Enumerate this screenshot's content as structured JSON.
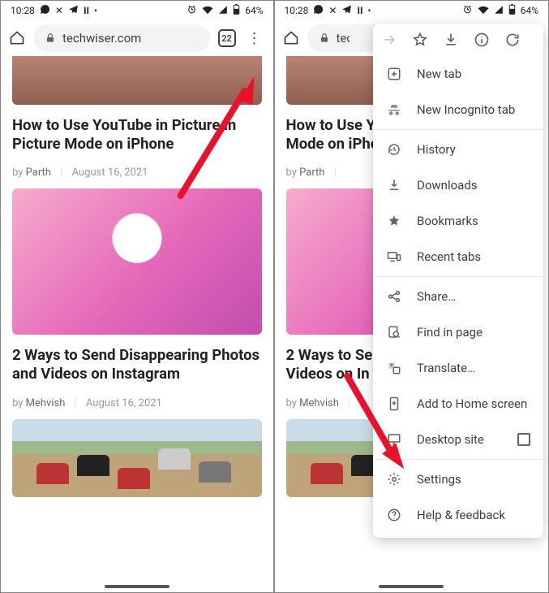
{
  "status": {
    "time": "10:28",
    "battery_text": "64%"
  },
  "omnibox": {
    "url": "techwiser.com",
    "tab_count": "22"
  },
  "articles": [
    {
      "title": "How to Use YouTube in Picture in Picture Mode on iPhone",
      "author": "Parth",
      "date": "August 16, 2021",
      "by": "by"
    },
    {
      "title": "2 Ways to Send Disappearing Photos and Videos on Instagram",
      "author": "Mehvish",
      "date": "August 16, 2021",
      "by": "by"
    }
  ],
  "article1_title_wrapped": "How to Use Yo…Mode on iPho…",
  "menu": {
    "new_tab": "New tab",
    "incognito": "New Incognito tab",
    "history": "History",
    "downloads": "Downloads",
    "bookmarks": "Bookmarks",
    "recent": "Recent tabs",
    "share": "Share…",
    "find": "Find in page",
    "translate": "Translate…",
    "homescreen": "Add to Home screen",
    "desktop": "Desktop site",
    "settings": "Settings",
    "help": "Help & feedback"
  }
}
